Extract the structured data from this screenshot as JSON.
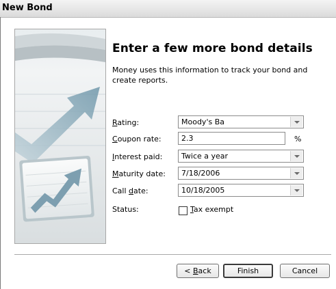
{
  "window": {
    "title": "New Bond"
  },
  "page": {
    "heading": "Enter a few more bond details",
    "description": "Money uses this information to track your bond and create reports."
  },
  "form": {
    "rating": {
      "label_key": "R",
      "label_rest": "ating:",
      "value": "Moody's Ba"
    },
    "coupon_rate": {
      "label_key": "C",
      "label_rest": "oupon rate:",
      "value": "2.3",
      "unit": "%"
    },
    "interest_paid": {
      "label_key": "I",
      "label_rest": "nterest paid:",
      "value": "Twice a year"
    },
    "maturity_date": {
      "label_key": "M",
      "label_rest": "aturity date:",
      "value": "7/18/2006"
    },
    "call_date": {
      "label_pre": "Call ",
      "label_key": "d",
      "label_rest": "ate:",
      "value": "10/18/2005"
    },
    "status": {
      "label": "Status:",
      "checkbox_key": "T",
      "checkbox_rest": "ax exempt",
      "checked": false
    }
  },
  "buttons": {
    "back": {
      "pre": "< ",
      "key": "B",
      "rest": "ack"
    },
    "finish": "Finish",
    "cancel": "Cancel"
  },
  "colors": {
    "title_bar": "#e6e6e6",
    "arrow": "#7aa0b2",
    "panel_border": "#a7a7a7"
  },
  "icons": {
    "illustration": "rising-chart-arrow-illustration"
  }
}
